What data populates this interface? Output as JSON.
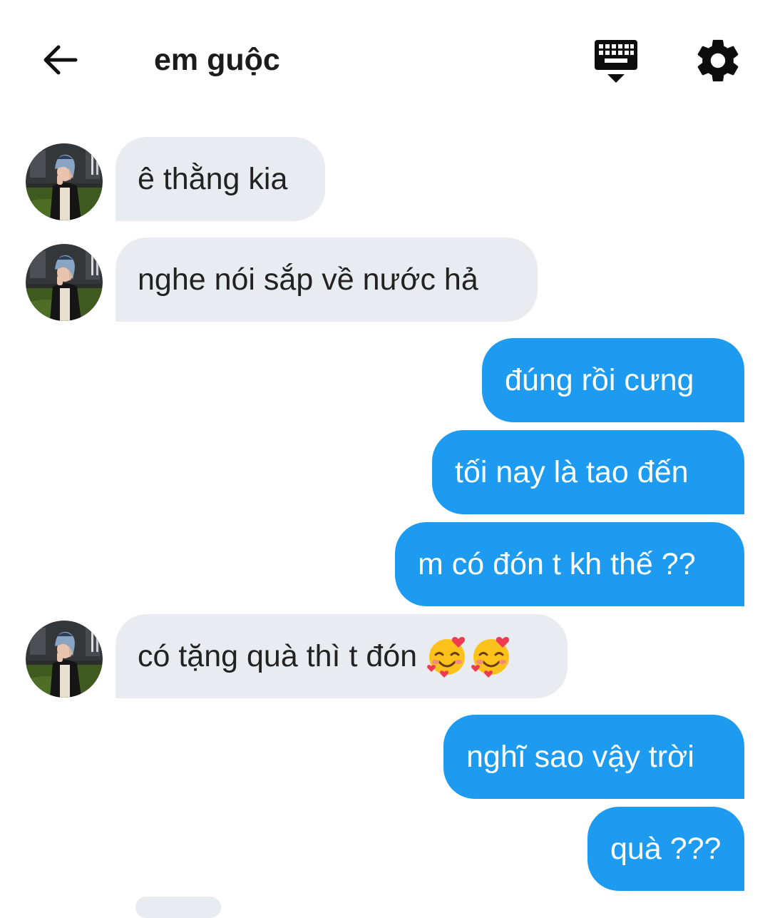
{
  "header": {
    "title": "em guộc"
  },
  "icons": {
    "back": "arrow-left-icon",
    "keyboard": "keyboard-hide-icon",
    "settings": "gear-icon",
    "emoji": "smiling-face-with-hearts"
  },
  "colors": {
    "outgoing_bubble": "#1d9bf0",
    "incoming_bubble": "#e8ebef",
    "text_dark": "#222222"
  },
  "messages": [
    {
      "sender": "them",
      "text": "ê thằng kia"
    },
    {
      "sender": "them",
      "text": "nghe nói sắp về nước hả"
    },
    {
      "sender": "me",
      "text": "đúng rồi cưng"
    },
    {
      "sender": "me",
      "text": "tối nay là tao đến"
    },
    {
      "sender": "me",
      "text": "m có đón t kh thế ??"
    },
    {
      "sender": "them",
      "text": "có tặng quà thì t đón",
      "emoji_count": 2
    },
    {
      "sender": "me",
      "text": "nghĩ sao vậy trời"
    },
    {
      "sender": "me",
      "text": "quà ???"
    }
  ]
}
